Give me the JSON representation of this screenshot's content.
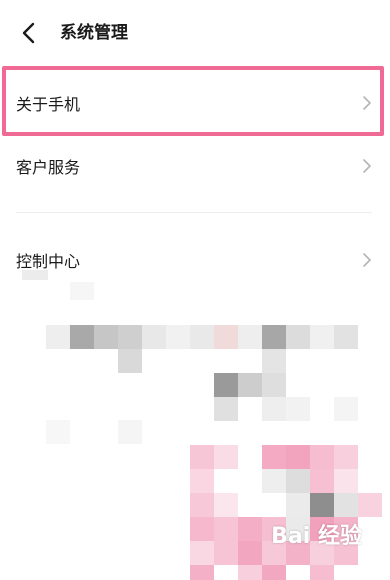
{
  "header": {
    "title": "系统管理"
  },
  "menu": [
    {
      "label": "关于手机"
    },
    {
      "label": "客户服务"
    },
    {
      "label": "控制中心"
    }
  ],
  "watermark": "Bai 经验",
  "colors": {
    "highlight": "#f06a96"
  }
}
